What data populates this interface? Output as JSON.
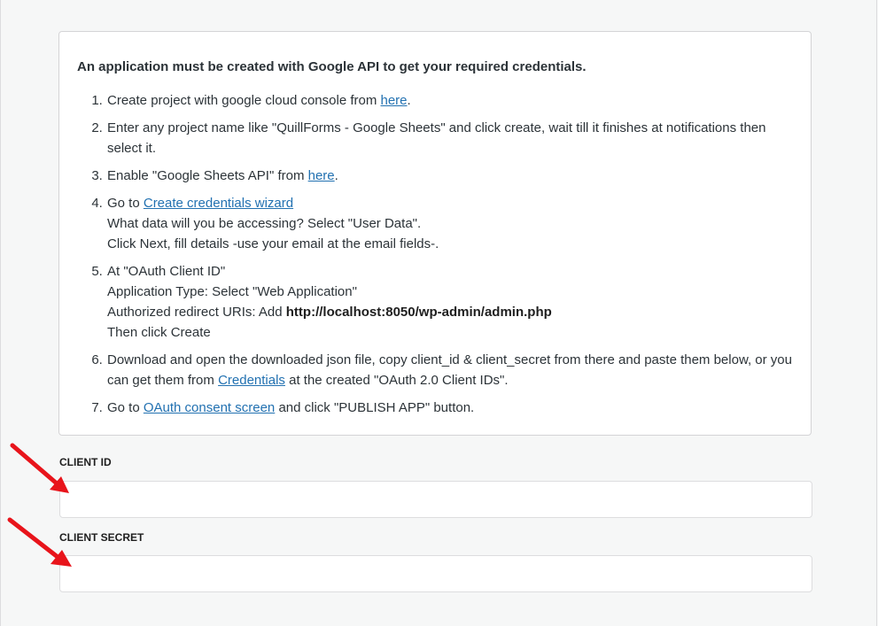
{
  "instructions": {
    "intro": "An application must be created with Google API to get your required credentials.",
    "steps": [
      {
        "parts": [
          {
            "type": "text",
            "value": "Create project with google cloud console from "
          },
          {
            "type": "link",
            "value": "here"
          },
          {
            "type": "text",
            "value": "."
          }
        ]
      },
      {
        "parts": [
          {
            "type": "text",
            "value": "Enter any project name like \"QuillForms - Google Sheets\" and click create, wait till it finishes at notifications then select it."
          }
        ]
      },
      {
        "parts": [
          {
            "type": "text",
            "value": "Enable \"Google Sheets API\" from "
          },
          {
            "type": "link",
            "value": "here"
          },
          {
            "type": "text",
            "value": "."
          }
        ]
      },
      {
        "lines": [
          [
            {
              "type": "text",
              "value": "Go to "
            },
            {
              "type": "link",
              "value": "Create credentials wizard"
            }
          ],
          [
            {
              "type": "text",
              "value": "What data will you be accessing? Select \"User Data\"."
            }
          ],
          [
            {
              "type": "text",
              "value": "Click Next, fill details -use your email at the email fields-."
            }
          ]
        ]
      },
      {
        "lines": [
          [
            {
              "type": "text",
              "value": "At \"OAuth Client ID\""
            }
          ],
          [
            {
              "type": "text",
              "value": "Application Type: Select \"Web Application\""
            }
          ],
          [
            {
              "type": "text",
              "value": "Authorized redirect URIs: Add "
            },
            {
              "type": "bold",
              "value": "http://localhost:8050/wp-admin/admin.php"
            }
          ],
          [
            {
              "type": "text",
              "value": "Then click Create"
            }
          ]
        ]
      },
      {
        "parts": [
          {
            "type": "text",
            "value": "Download and open the downloaded json file, copy client_id & client_secret from there and paste them below, or you can get them from "
          },
          {
            "type": "link",
            "value": "Credentials"
          },
          {
            "type": "text",
            "value": " at the created \"OAuth 2.0 Client IDs\"."
          }
        ]
      },
      {
        "parts": [
          {
            "type": "text",
            "value": "Go to "
          },
          {
            "type": "link",
            "value": "OAuth consent screen"
          },
          {
            "type": "text",
            "value": " and click \"PUBLISH APP\" button."
          }
        ]
      }
    ]
  },
  "fields": {
    "client_id": {
      "label": "CLIENT ID",
      "value": ""
    },
    "client_secret": {
      "label": "CLIENT SECRET",
      "value": ""
    }
  },
  "colors": {
    "link": "#2271b1",
    "arrow": "#e8141b",
    "background": "#f6f7f7"
  },
  "icons": {
    "arrow_1": "red-arrow-icon",
    "arrow_2": "red-arrow-icon"
  }
}
